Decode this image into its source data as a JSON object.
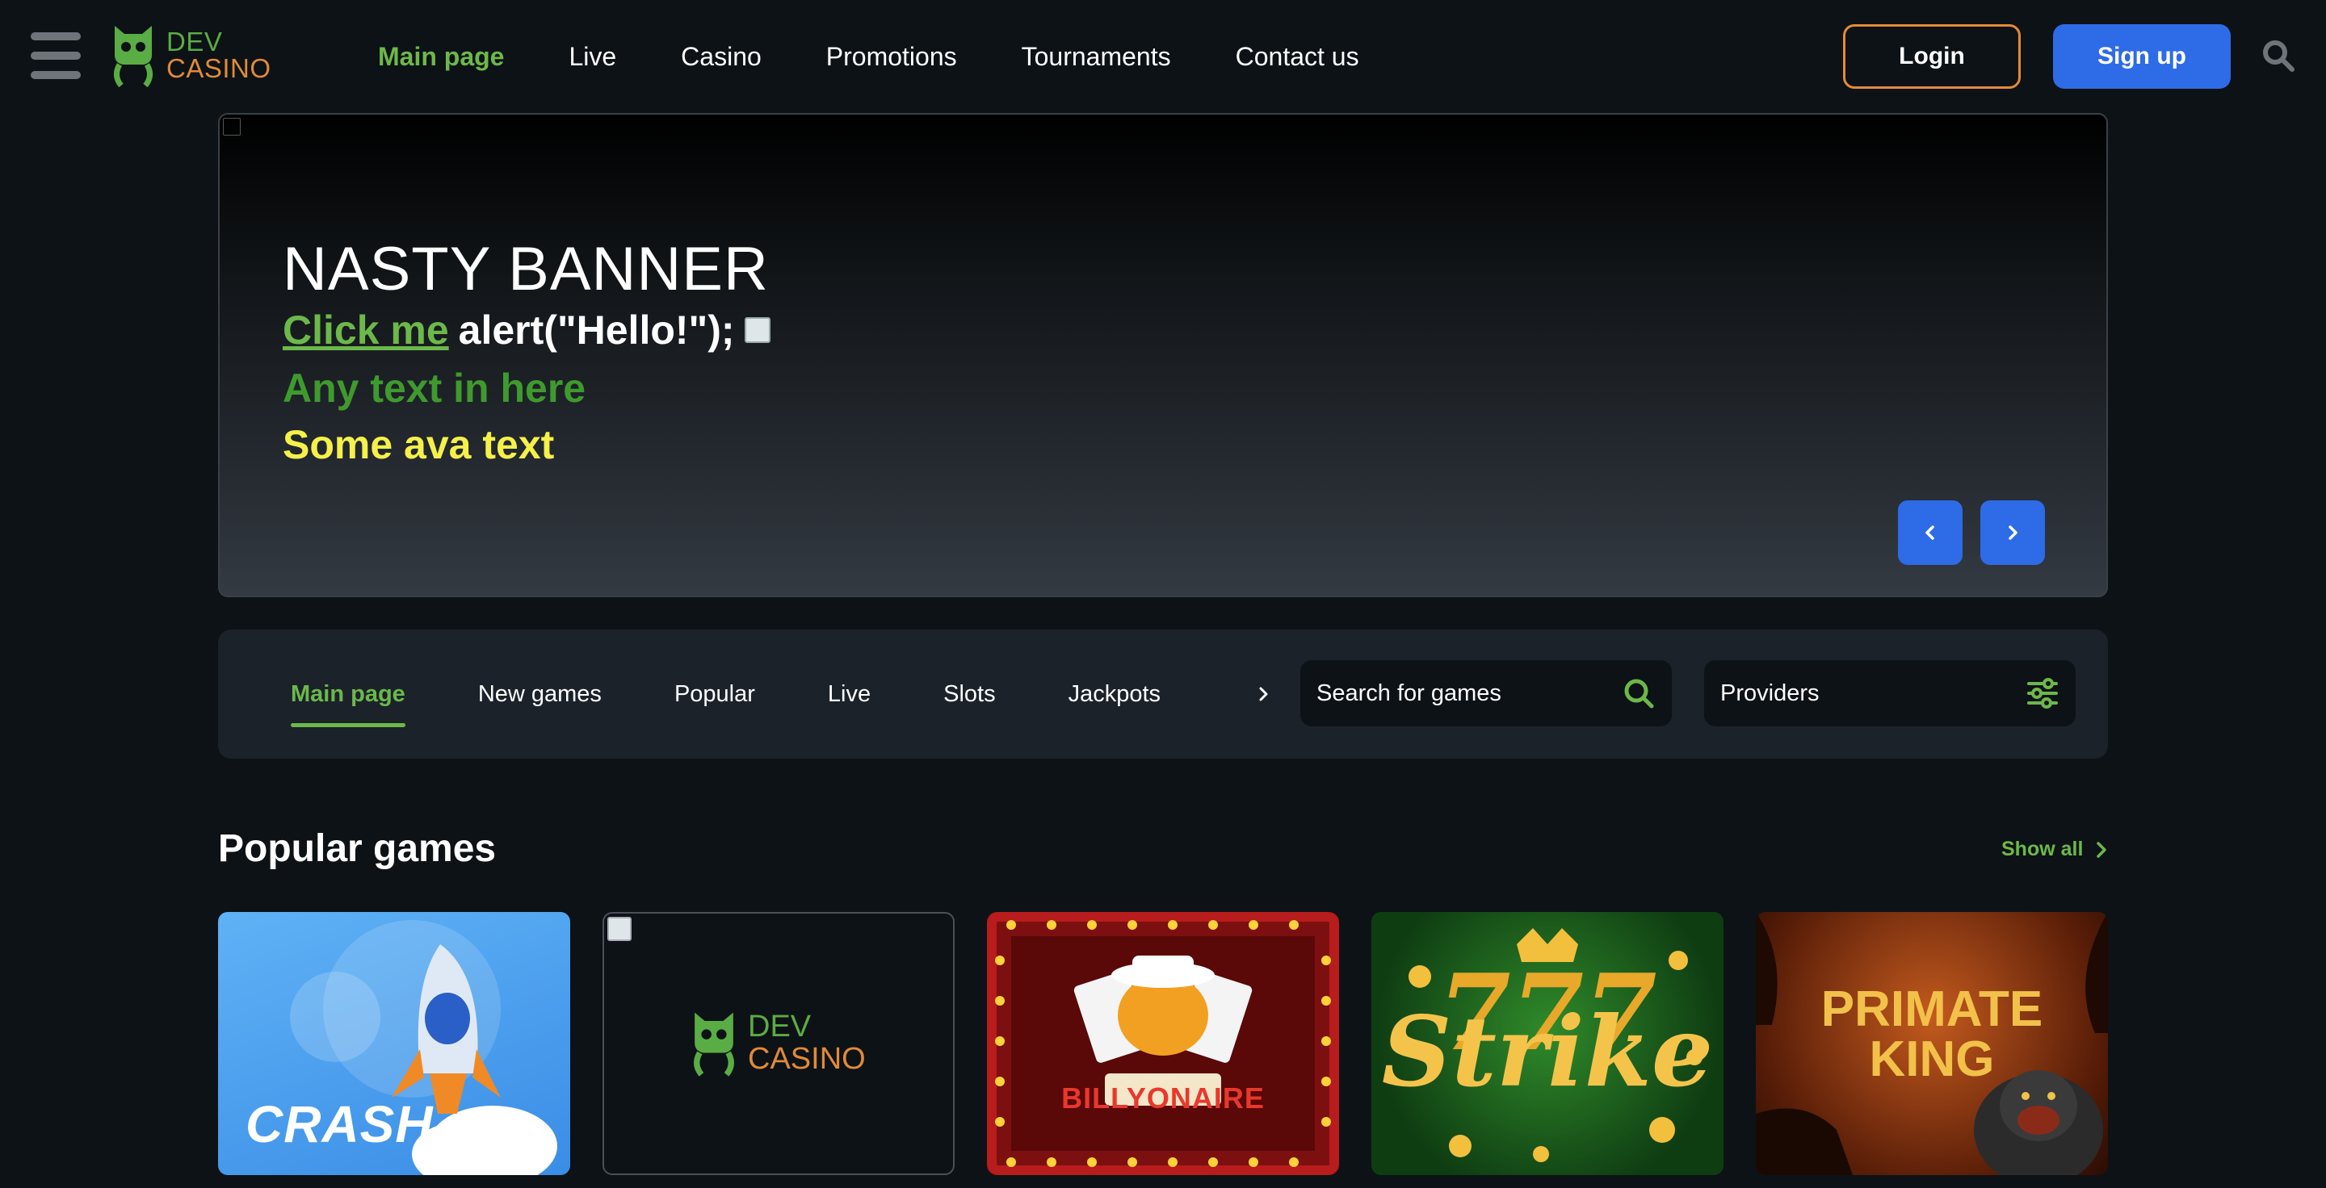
{
  "header": {
    "logo_line1": "DEV",
    "logo_line2": "CASINO",
    "nav": [
      "Main page",
      "Live",
      "Casino",
      "Promotions",
      "Tournaments",
      "Contact us"
    ],
    "active_nav": "Main page",
    "login_label": "Login",
    "signup_label": "Sign up",
    "icons": {
      "menu": "hamburger-menu-icon",
      "search": "search-icon"
    }
  },
  "banner": {
    "title": "NASTY BANNER",
    "link_text": "Click me",
    "code_text": "alert(\"Hello!\");",
    "line2": "Any text in here",
    "line3": "Some ava text",
    "colors": {
      "link": "#6cb84a",
      "line2": "#3f9a2e",
      "line3": "#f5f04a"
    }
  },
  "categories": {
    "tabs": [
      "Main page",
      "New games",
      "Popular",
      "Live",
      "Slots",
      "Jackpots"
    ],
    "active_tab": "Main page",
    "search_placeholder": "Search for games",
    "providers_label": "Providers"
  },
  "popular": {
    "title": "Popular games",
    "show_all": "Show all",
    "games": [
      {
        "title": "CRASH"
      },
      {
        "title_line1": "DEV",
        "title_line2": "CASINO"
      },
      {
        "title": "BILLYONAIRE"
      },
      {
        "title": "Strike"
      },
      {
        "title_line1": "PRIMATE",
        "title_line2": "KING"
      }
    ]
  },
  "colors": {
    "background": "#0d1216",
    "accent_green": "#6cb84a",
    "accent_orange": "#e58a35",
    "accent_blue": "#2e6be6",
    "panel": "#1b222a"
  }
}
